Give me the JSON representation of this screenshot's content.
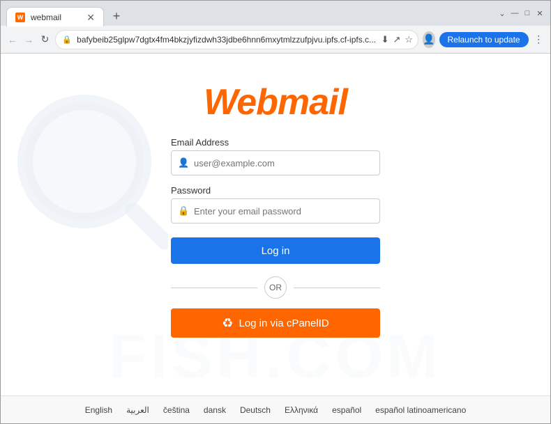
{
  "browser": {
    "tab_title": "webmail",
    "url": "bafybeib25glpw7dgtx4fm4bkzjyfizdwh33jdbe6hnn6mxytmlzzufpjvu.ipfs.cf-ipfs.c...",
    "new_tab_icon": "+",
    "minimize_icon": "—",
    "maximize_icon": "□",
    "close_icon": "✕",
    "tab_close_icon": "✕",
    "nav": {
      "back": "←",
      "forward": "→",
      "reload": "↻"
    },
    "relaunch_btn": "Relaunch to update",
    "more_icon": "⋮"
  },
  "page": {
    "logo": "Webmail",
    "form": {
      "email_label": "Email Address",
      "email_placeholder": "user@example.com",
      "password_label": "Password",
      "password_placeholder": "Enter your email password",
      "login_btn": "Log in",
      "or_text": "OR",
      "cpanel_btn": "Log in via cPanelID"
    },
    "languages": [
      "English",
      "العربية",
      "čeština",
      "dansk",
      "Deutsch",
      "Ελληνικά",
      "español",
      "español latinoamericano"
    ],
    "watermark_text": "FISH.COM"
  }
}
